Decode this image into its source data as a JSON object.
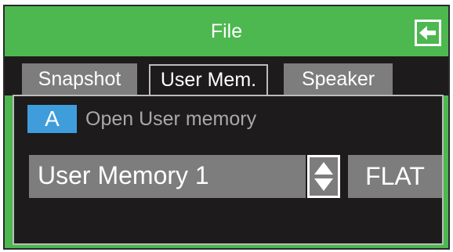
{
  "window": {
    "title": "File"
  },
  "tabs": [
    {
      "label": "Snapshot",
      "active": false
    },
    {
      "label": "User Mem.",
      "active": true
    },
    {
      "label": "Speaker",
      "active": false
    }
  ],
  "panel": {
    "slot_badge": "A",
    "slot_label": "Open User memory",
    "selected_memory": "User Memory 1",
    "eq_button_label": "FLAT"
  },
  "icons": {
    "back": "back-arrow-icon",
    "stepper": "up-down-stepper-icon"
  },
  "colors": {
    "title_bar": "#4cb84f",
    "background": "#1d1b1b",
    "control": "#7d7d7d",
    "badge": "#3f9ddc",
    "muted_text": "#a9a9a9"
  }
}
